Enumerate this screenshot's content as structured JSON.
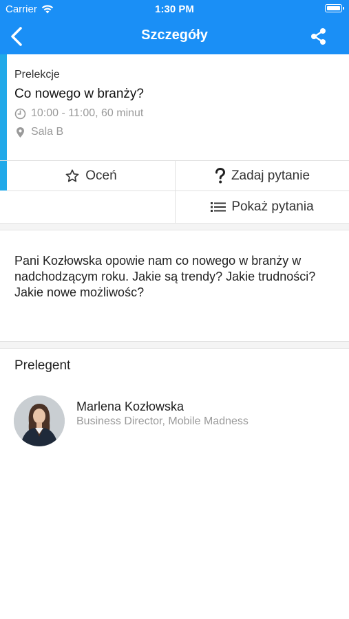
{
  "status_bar": {
    "carrier": "Carrier",
    "time": "1:30 PM"
  },
  "nav": {
    "title": "Szczegóły",
    "back_icon": "chevron-left-icon",
    "share_icon": "share-icon"
  },
  "session": {
    "category": "Prelekcje",
    "title": "Co nowego w branży?",
    "time": "10:00 - 11:00, 60 minut",
    "room": "Sala B"
  },
  "actions": {
    "rate": "Oceń",
    "ask": "Zadaj pytanie",
    "show_questions": "Pokaż pytania"
  },
  "description": "Pani Kozłowska opowie nam co nowego w branży w nadchodzącym roku. Jakie są trendy? Jakie trudności? Jakie nowe możliwośc?",
  "speaker_section": {
    "title": "Prelegent",
    "name": "Marlena Kozłowska",
    "role": "Business Director, Mobile Madness"
  },
  "colors": {
    "nav_background": "#1a8ff6",
    "accent": "#21a9e9"
  }
}
